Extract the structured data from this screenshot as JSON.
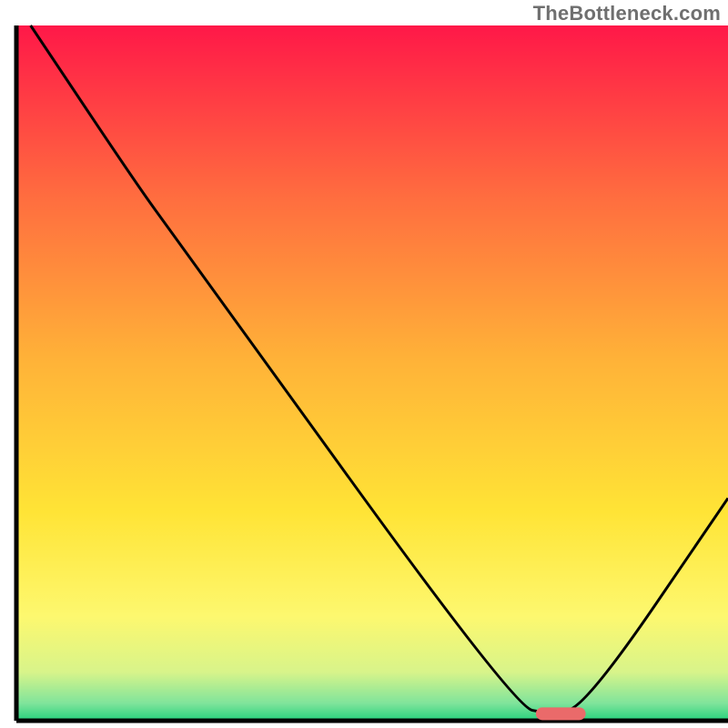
{
  "watermark": "TheBottleneck.com",
  "chart_data": {
    "type": "line",
    "title": "",
    "xlabel": "",
    "ylabel": "",
    "xlim": [
      0,
      100
    ],
    "ylim": [
      0,
      100
    ],
    "series": [
      {
        "name": "bottleneck-curve",
        "x": [
          2,
          17,
          22,
          70,
          75,
          80,
          100
        ],
        "values": [
          100,
          77,
          70,
          2,
          1,
          2,
          32
        ]
      }
    ],
    "marker": {
      "name": "optimal-range",
      "x_range": [
        73,
        80
      ],
      "y": 1,
      "color": "#ea6a6a"
    },
    "background_gradient": {
      "stops": [
        {
          "offset": 0.0,
          "color": "#ff1848"
        },
        {
          "offset": 0.25,
          "color": "#ff6e3f"
        },
        {
          "offset": 0.48,
          "color": "#ffb238"
        },
        {
          "offset": 0.7,
          "color": "#ffe436"
        },
        {
          "offset": 0.85,
          "color": "#fdf86f"
        },
        {
          "offset": 0.93,
          "color": "#d8f48a"
        },
        {
          "offset": 0.975,
          "color": "#7fe49b"
        },
        {
          "offset": 1.0,
          "color": "#26d07c"
        }
      ]
    },
    "axis_color": "#000000",
    "line_color": "#000000"
  }
}
